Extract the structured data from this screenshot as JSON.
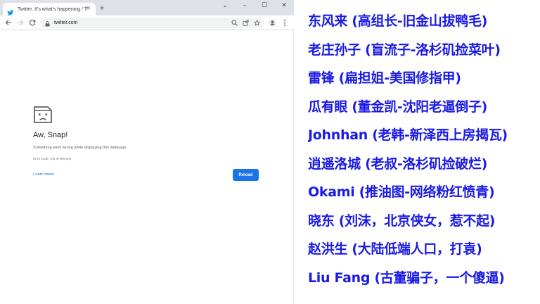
{
  "browser": {
    "tab": {
      "title": "Twitter. It's what's happening / T",
      "close": "×"
    },
    "new_tab": "+",
    "window_controls": {
      "minimize": "⌄",
      "restore": "–",
      "maximize": "☐",
      "close": "✕"
    },
    "url": "twitter.com",
    "icons": {
      "favicon": "twitter-bird-icon",
      "back": "back-arrow-icon",
      "forward": "forward-arrow-icon",
      "reload": "reload-icon",
      "lock": "lock-icon",
      "zoom": "zoom-icon",
      "share": "share-icon",
      "bookmark": "star-icon",
      "profile": "profile-icon",
      "menu": "kebab-menu-icon"
    },
    "colors": {
      "tabstrip": "#dee1e6",
      "accent": "#1a73e8",
      "twitter": "#1d9bf0"
    }
  },
  "error_page": {
    "icon": "sad-tab-icon",
    "title": "Aw, Snap!",
    "message": "Something went wrong while displaying this webpage.",
    "code": "Error code: Out of Memory",
    "learn_more": "Learn more",
    "reload": "Reload"
  },
  "captions": {
    "color": "#1a1ae6",
    "lines": [
      "东风来 (高组长-旧金山拔鸭毛)",
      "老庄孙子 (盲流子-洛杉矶捡菜叶)",
      "雷锋  (扁担姐-美国修指甲)",
      "瓜有眼  (董金凯-沈阳老逼倒子)",
      "Johnhan (老韩-新泽西上房揭瓦)",
      "逍遥洛城  (老叔-洛杉矶捡破烂)",
      "Okami (推油图-网络粉红愤青)",
      "晓东  (刘沫，北京侠女，惹不起)",
      "赵洪生  (大陆低端人口，打袁)",
      "Liu Fang  (古董骗子，一个傻逼)"
    ]
  }
}
